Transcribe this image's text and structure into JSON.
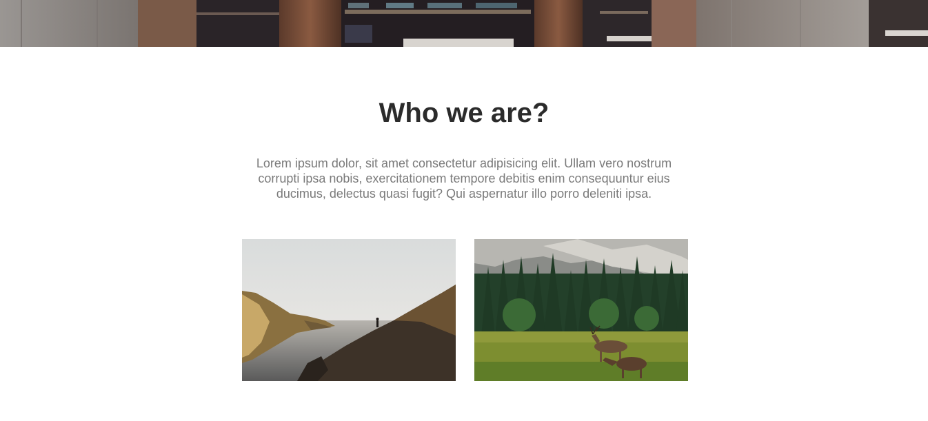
{
  "header_image": {
    "icon": "restaurant-interior-photo"
  },
  "about": {
    "title": "Who we are?",
    "description": "Lorem ipsum dolor, sit amet consectetur adipisicing elit. Ullam vero nostrum corrupti ipsa nobis, exercitationem tempore debitis enim consequuntur eius ducimus, delectus quasi fugit? Qui aspernatur illo porro deleniti ipsa."
  },
  "gallery": {
    "items": [
      {
        "icon": "coastal-cliff-hiker-photo"
      },
      {
        "icon": "forest-meadow-deer-photo"
      }
    ]
  },
  "colors": {
    "title": "#2b2b2b",
    "body_text": "#7a7a7a",
    "background": "#ffffff"
  }
}
